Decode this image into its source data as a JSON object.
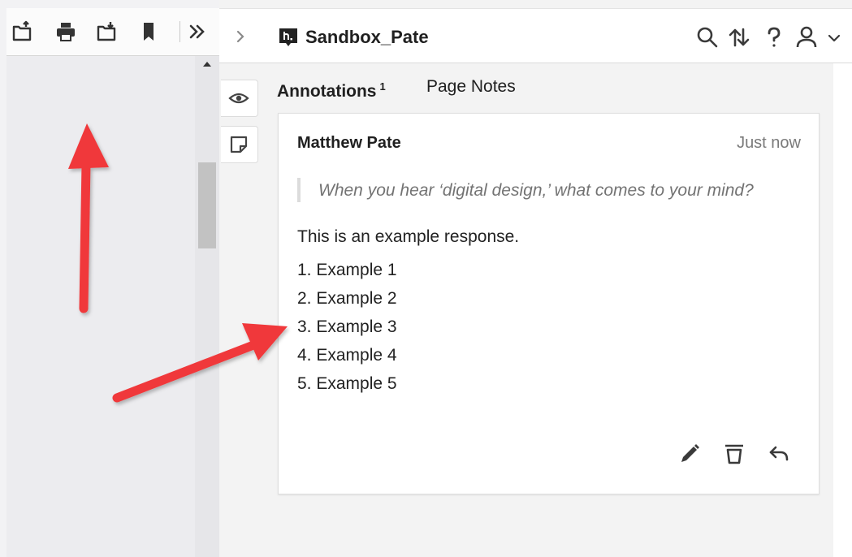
{
  "sidebar": {
    "group_name": "Sandbox_Pate",
    "tabs": [
      {
        "label": "Annotations",
        "count": "1"
      },
      {
        "label": "Page Notes"
      }
    ]
  },
  "annotation": {
    "author": "Matthew Pate",
    "timestamp": "Just now",
    "quote": "When you hear ‘digital design,’ what comes to your mind?",
    "body": "This is an example response.",
    "list": [
      "1. Example 1",
      "2. Example 2",
      "3. Example 3",
      "4. Example 4",
      "5. Example 5"
    ]
  },
  "icons": {
    "viewer_toolbar": [
      "open-file-icon",
      "print-icon",
      "save-icon",
      "bookmark-icon",
      "double-chevron-right-icon"
    ],
    "header": [
      "search-icon",
      "sort-icon",
      "help-icon",
      "user-icon",
      "chevron-down-icon"
    ],
    "rail": [
      "eye-icon",
      "page-note-icon"
    ],
    "actions": [
      "edit-icon",
      "delete-icon",
      "reply-icon"
    ]
  },
  "colors": {
    "arrow": "#f0393b",
    "text": "#202020",
    "muted": "#737373"
  }
}
